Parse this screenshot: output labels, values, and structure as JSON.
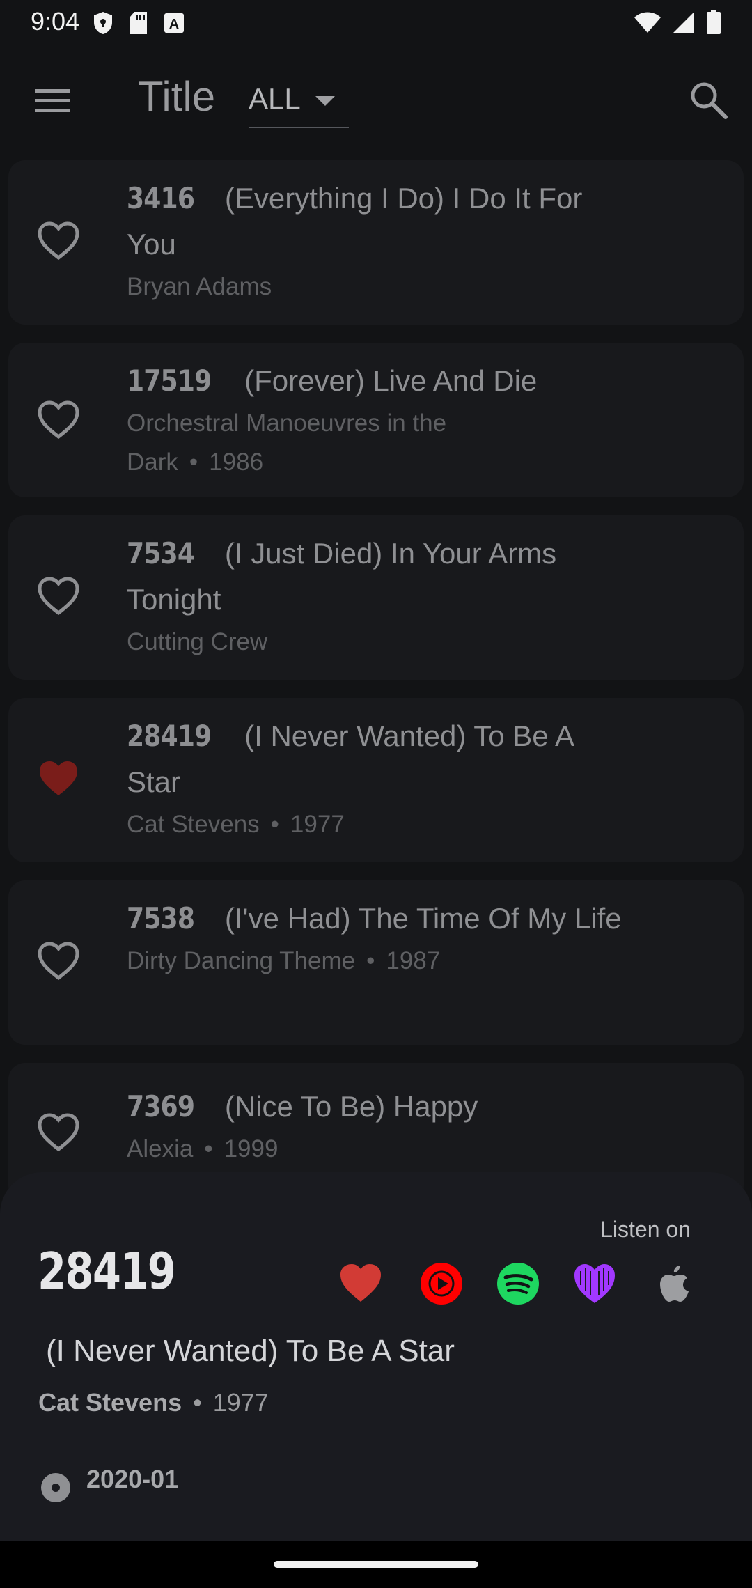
{
  "status_bar": {
    "time": "9:04",
    "left_icons": [
      "shield-icon",
      "sd-card-icon",
      "text-box-icon"
    ],
    "right_icons": [
      "wifi-icon",
      "signal-icon",
      "battery-icon"
    ]
  },
  "app_bar": {
    "title": "Title",
    "filter_value": "ALL",
    "menu_icon": "hamburger-menu-icon",
    "search_icon": "search-icon"
  },
  "songs": [
    {
      "number": "3416",
      "title": "(Everything I Do) I Do It For You",
      "artist": "Bryan Adams",
      "year": "",
      "favorite": false
    },
    {
      "number": "17519",
      "title": "(Forever) Live And Die",
      "artist": "Orchestral Manoeuvres in the Dark",
      "year": "1986",
      "favorite": false
    },
    {
      "number": "7534",
      "title": "(I Just Died) In Your Arms Tonight",
      "artist": "Cutting Crew",
      "year": "",
      "favorite": false
    },
    {
      "number": "28419",
      "title": "(I Never Wanted) To Be A Star",
      "artist": "Cat Stevens",
      "year": "1977",
      "favorite": true
    },
    {
      "number": "7538",
      "title": "(I've Had) The Time Of My Life",
      "artist": "Dirty Dancing Theme",
      "year": "1987",
      "favorite": false
    },
    {
      "number": "7369",
      "title": "(Nice To Be) Happy",
      "artist": "Alexia",
      "year": "1999",
      "favorite": false
    }
  ],
  "sheet": {
    "listen_on": "Listen on",
    "number": "28419",
    "title": "(I Never Wanted) To Be A Star",
    "artist": "Cat Stevens",
    "separator": "•",
    "year": "1977",
    "date": "2020-01",
    "services": [
      "favorite-heart-icon",
      "youtube-music-icon",
      "spotify-icon",
      "deezer-icon",
      "apple-music-icon"
    ]
  },
  "colors": {
    "background": "#121315",
    "card": "#18191c",
    "sheet": "#1a1b20",
    "favorite_red": "#d23b35",
    "favorite_dim_red": "#7a1d1a",
    "youtube_red": "#ff0000",
    "spotify_green": "#1ed760",
    "deezer_purple": "#a238ff"
  }
}
